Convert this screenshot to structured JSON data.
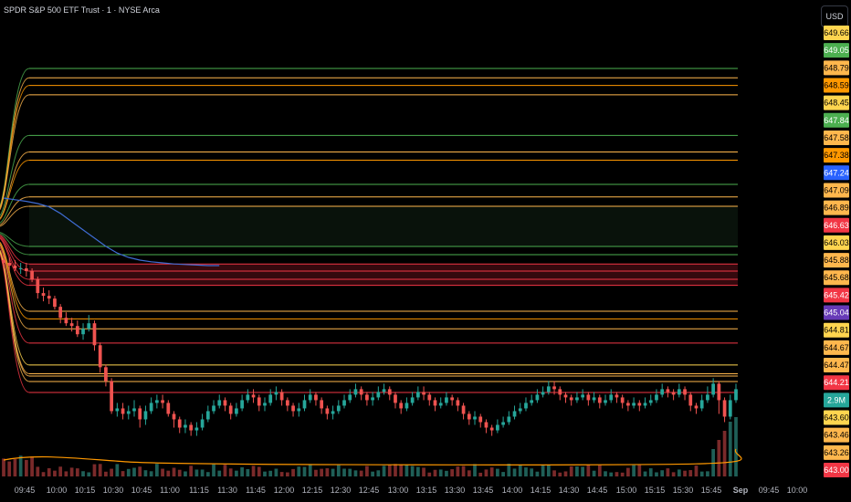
{
  "header": {
    "title": "SPDR S&P 500 ETF Trust · 1 · NYSE Arca",
    "currency": "USD"
  },
  "colors": {
    "up": "#26a69a",
    "down": "#ef5350",
    "green_level": "#4caf50",
    "orange_level": "#ffb74d",
    "red_level": "#f23645",
    "vwap": "#3f6cd3",
    "volume_ma": "#ff9800"
  },
  "chart_data": {
    "type": "candlestick",
    "ylim": [
      643.0,
      649.8
    ],
    "x_ticks": [
      "09:45",
      "10:00",
      "10:15",
      "10:30",
      "10:45",
      "11:00",
      "11:15",
      "11:30",
      "11:45",
      "12:00",
      "12:15",
      "12:30",
      "12:45",
      "13:00",
      "13:15",
      "13:30",
      "13:45",
      "14:00",
      "14:15",
      "14:30",
      "14:45",
      "15:00",
      "15:15",
      "15:30",
      "15:45",
      "Sep",
      "09:45",
      "10:00"
    ],
    "price_labels": [
      {
        "value": "649.66",
        "bg": "#ffd54f",
        "fg": "#000000"
      },
      {
        "value": "649.05",
        "bg": "#4caf50",
        "fg": "#ffffff"
      },
      {
        "value": "648.79",
        "bg": "#ffb74d",
        "fg": "#000000"
      },
      {
        "value": "648.59",
        "bg": "#ff9800",
        "fg": "#000000"
      },
      {
        "value": "648.45",
        "bg": "#ffd54f",
        "fg": "#000000"
      },
      {
        "value": "647.84",
        "bg": "#4caf50",
        "fg": "#ffffff"
      },
      {
        "value": "647.58",
        "bg": "#ffb74d",
        "fg": "#000000"
      },
      {
        "value": "647.38",
        "bg": "#ff9800",
        "fg": "#000000"
      },
      {
        "value": "647.24",
        "bg": "#2962ff",
        "fg": "#ffffff"
      },
      {
        "value": "647.09",
        "bg": "#ffb74d",
        "fg": "#000000"
      },
      {
        "value": "646.89",
        "bg": "#ffb74d",
        "fg": "#000000"
      },
      {
        "value": "646.63",
        "bg": "#f23645",
        "fg": "#ffffff"
      },
      {
        "value": "646.03",
        "bg": "#ffd54f",
        "fg": "#000000"
      },
      {
        "value": "645.88",
        "bg": "#ffb74d",
        "fg": "#000000"
      },
      {
        "value": "645.68",
        "bg": "#ffb74d",
        "fg": "#000000"
      },
      {
        "value": "645.42",
        "bg": "#f23645",
        "fg": "#ffffff"
      },
      {
        "value": "645.04",
        "bg": "#673ab7",
        "fg": "#ffffff"
      },
      {
        "value": "644.81",
        "bg": "#ffd54f",
        "fg": "#000000"
      },
      {
        "value": "644.67",
        "bg": "#ffb74d",
        "fg": "#000000"
      },
      {
        "value": "644.47",
        "bg": "#ffb74d",
        "fg": "#000000"
      },
      {
        "value": "644.21",
        "bg": "#f23645",
        "fg": "#ffffff"
      },
      {
        "value": "2.9M",
        "bg": "#26a69a",
        "fg": "#ffffff"
      },
      {
        "value": "643.60",
        "bg": "#ffd54f",
        "fg": "#000000"
      },
      {
        "value": "643.46",
        "bg": "#ffb74d",
        "fg": "#000000"
      },
      {
        "value": "643.26",
        "bg": "#ffb74d",
        "fg": "#000000"
      },
      {
        "value": "643.00",
        "bg": "#f23645",
        "fg": "#ffffff"
      }
    ],
    "levels": [
      {
        "price": 649.14,
        "color": "#4caf50"
      },
      {
        "price": 648.97,
        "color": "#ffb74d"
      },
      {
        "price": 648.83,
        "color": "#ff9800"
      },
      {
        "price": 648.66,
        "color": "#ffb74d"
      },
      {
        "price": 647.92,
        "color": "#4caf50"
      },
      {
        "price": 647.62,
        "color": "#ffb74d"
      },
      {
        "price": 647.47,
        "color": "#ff9800"
      },
      {
        "price": 647.03,
        "color": "#4caf50"
      },
      {
        "price": 646.8,
        "color": "#ffb74d"
      },
      {
        "price": 646.63,
        "color": "#ffb74d"
      },
      {
        "price": 645.9,
        "color": "#4caf50"
      },
      {
        "price": 645.75,
        "color": "#4caf50"
      },
      {
        "price": 645.58,
        "color": "#f23645"
      },
      {
        "price": 645.45,
        "color": "#f23645"
      },
      {
        "price": 645.3,
        "color": "#f23645"
      },
      {
        "price": 645.19,
        "color": "#f23645"
      },
      {
        "price": 644.72,
        "color": "#ffb74d"
      },
      {
        "price": 644.58,
        "color": "#ff9800"
      },
      {
        "price": 644.4,
        "color": "#ffb74d"
      },
      {
        "price": 644.14,
        "color": "#f23645"
      },
      {
        "price": 643.74,
        "color": "#ffd54f"
      },
      {
        "price": 643.58,
        "color": "#ffb74d"
      },
      {
        "price": 643.54,
        "color": "#ffb74d"
      },
      {
        "price": 643.44,
        "color": "#ffb74d"
      },
      {
        "price": 643.24,
        "color": "#f23645"
      }
    ],
    "candles": [
      [
        645.65,
        645.6,
        645.75,
        645.5
      ],
      [
        645.6,
        645.55,
        645.7,
        645.45
      ],
      [
        645.55,
        645.5,
        645.65,
        645.45
      ],
      [
        645.5,
        645.5,
        645.6,
        645.4
      ],
      [
        645.5,
        645.45,
        645.6,
        645.35
      ],
      [
        645.45,
        645.3,
        645.5,
        645.25
      ],
      [
        645.3,
        645.05,
        645.35,
        644.95
      ],
      [
        645.05,
        645.0,
        645.15,
        644.9
      ],
      [
        645.0,
        644.95,
        645.1,
        644.85
      ],
      [
        644.95,
        644.8,
        645.0,
        644.75
      ],
      [
        644.8,
        644.6,
        644.85,
        644.5
      ],
      [
        644.6,
        644.5,
        644.7,
        644.45
      ],
      [
        644.5,
        644.45,
        644.6,
        644.35
      ],
      [
        644.45,
        644.3,
        644.55,
        644.25
      ],
      [
        644.3,
        644.4,
        644.5,
        644.2
      ],
      [
        644.4,
        644.5,
        644.65,
        644.35
      ],
      [
        644.5,
        644.1,
        644.55,
        644.0
      ],
      [
        644.1,
        643.7,
        644.15,
        643.6
      ],
      [
        643.7,
        643.45,
        643.75,
        643.35
      ],
      [
        643.45,
        642.9,
        643.5,
        642.85
      ],
      [
        642.9,
        642.95,
        643.05,
        642.8
      ],
      [
        642.95,
        642.85,
        643.05,
        642.75
      ],
      [
        642.85,
        642.9,
        643.0,
        642.75
      ],
      [
        642.9,
        642.95,
        643.1,
        642.8
      ],
      [
        642.95,
        642.75,
        643.0,
        642.6
      ],
      [
        642.75,
        642.9,
        643.0,
        642.65
      ],
      [
        642.9,
        643.05,
        643.15,
        642.85
      ],
      [
        643.05,
        643.1,
        643.2,
        642.95
      ],
      [
        643.1,
        643.05,
        643.2,
        642.95
      ],
      [
        643.05,
        642.85,
        643.1,
        642.8
      ],
      [
        642.85,
        642.75,
        642.9,
        642.6
      ],
      [
        642.75,
        642.6,
        642.8,
        642.5
      ],
      [
        642.6,
        642.65,
        642.75,
        642.5
      ],
      [
        642.65,
        642.55,
        642.7,
        642.45
      ],
      [
        642.55,
        642.6,
        642.7,
        642.45
      ],
      [
        642.6,
        642.75,
        642.85,
        642.55
      ],
      [
        642.75,
        642.9,
        643.0,
        642.7
      ],
      [
        642.9,
        643.0,
        643.1,
        642.85
      ],
      [
        643.0,
        643.1,
        643.2,
        642.95
      ],
      [
        643.1,
        643.0,
        643.15,
        642.9
      ],
      [
        643.0,
        642.85,
        643.05,
        642.75
      ],
      [
        642.85,
        642.95,
        643.05,
        642.8
      ],
      [
        642.95,
        643.1,
        643.2,
        642.9
      ],
      [
        643.1,
        643.2,
        643.3,
        643.05
      ],
      [
        643.2,
        643.15,
        643.3,
        643.05
      ],
      [
        643.15,
        643.0,
        643.2,
        642.9
      ],
      [
        643.0,
        643.05,
        643.15,
        642.9
      ],
      [
        643.05,
        643.2,
        643.3,
        643.0
      ],
      [
        643.2,
        643.25,
        643.35,
        643.1
      ],
      [
        643.25,
        643.1,
        643.3,
        643.0
      ],
      [
        643.1,
        643.0,
        643.15,
        642.9
      ],
      [
        643.0,
        642.9,
        643.05,
        642.8
      ],
      [
        642.9,
        642.95,
        643.05,
        642.8
      ],
      [
        642.95,
        643.1,
        643.2,
        642.9
      ],
      [
        643.1,
        643.2,
        643.3,
        643.05
      ],
      [
        643.2,
        643.1,
        643.25,
        643.0
      ],
      [
        643.1,
        642.95,
        643.15,
        642.85
      ],
      [
        642.95,
        642.85,
        643.0,
        642.75
      ],
      [
        642.85,
        642.9,
        643.0,
        642.75
      ],
      [
        642.9,
        643.0,
        643.1,
        642.85
      ],
      [
        643.0,
        643.1,
        643.2,
        642.95
      ],
      [
        643.1,
        643.2,
        643.3,
        643.05
      ],
      [
        643.2,
        643.3,
        643.4,
        643.15
      ],
      [
        643.3,
        643.2,
        643.35,
        643.1
      ],
      [
        643.2,
        643.1,
        643.25,
        643.0
      ],
      [
        643.1,
        643.15,
        643.25,
        643.0
      ],
      [
        643.15,
        643.25,
        643.35,
        643.1
      ],
      [
        643.25,
        643.3,
        643.4,
        643.2
      ],
      [
        643.3,
        643.2,
        643.35,
        643.1
      ],
      [
        643.2,
        643.05,
        643.25,
        642.95
      ],
      [
        643.05,
        642.95,
        643.1,
        642.85
      ],
      [
        642.95,
        643.05,
        643.15,
        642.9
      ],
      [
        643.05,
        643.15,
        643.25,
        643.0
      ],
      [
        643.15,
        643.25,
        643.35,
        643.1
      ],
      [
        643.25,
        643.2,
        643.35,
        643.1
      ],
      [
        643.2,
        643.1,
        643.25,
        643.0
      ],
      [
        643.1,
        643.0,
        643.15,
        642.9
      ],
      [
        643.0,
        643.05,
        643.15,
        642.95
      ],
      [
        643.05,
        643.15,
        643.25,
        643.0
      ],
      [
        643.15,
        643.1,
        643.2,
        643.0
      ],
      [
        643.1,
        643.0,
        643.15,
        642.9
      ],
      [
        643.0,
        642.85,
        643.05,
        642.75
      ],
      [
        642.85,
        642.75,
        642.9,
        642.65
      ],
      [
        642.75,
        642.8,
        642.9,
        642.65
      ],
      [
        642.8,
        642.7,
        642.85,
        642.6
      ],
      [
        642.7,
        642.6,
        642.75,
        642.5
      ],
      [
        642.6,
        642.55,
        642.65,
        642.45
      ],
      [
        642.55,
        642.65,
        642.75,
        642.5
      ],
      [
        642.65,
        642.7,
        642.8,
        642.6
      ],
      [
        642.7,
        642.8,
        642.9,
        642.65
      ],
      [
        642.8,
        642.9,
        643.0,
        642.75
      ],
      [
        642.9,
        642.95,
        643.05,
        642.85
      ],
      [
        642.95,
        643.05,
        643.15,
        642.9
      ],
      [
        643.05,
        643.1,
        643.2,
        643.0
      ],
      [
        643.1,
        643.2,
        643.3,
        643.05
      ],
      [
        643.2,
        643.25,
        643.35,
        643.15
      ],
      [
        643.25,
        643.35,
        643.45,
        643.2
      ],
      [
        643.35,
        643.3,
        643.45,
        643.2
      ],
      [
        643.3,
        643.2,
        643.35,
        643.1
      ],
      [
        643.2,
        643.15,
        643.25,
        643.05
      ],
      [
        643.15,
        643.1,
        643.2,
        643.0
      ],
      [
        643.1,
        643.15,
        643.25,
        643.05
      ],
      [
        643.15,
        643.2,
        643.3,
        643.1
      ],
      [
        643.2,
        643.1,
        643.25,
        643.0
      ],
      [
        643.1,
        643.15,
        643.25,
        643.05
      ],
      [
        643.15,
        643.05,
        643.2,
        642.95
      ],
      [
        643.05,
        643.1,
        643.2,
        643.0
      ],
      [
        643.1,
        643.2,
        643.3,
        643.05
      ],
      [
        643.2,
        643.15,
        643.25,
        643.05
      ],
      [
        643.15,
        643.05,
        643.2,
        642.95
      ],
      [
        643.05,
        643.0,
        643.1,
        642.9
      ],
      [
        643.0,
        643.05,
        643.15,
        642.95
      ],
      [
        643.05,
        643.0,
        643.1,
        642.9
      ],
      [
        643.0,
        643.05,
        643.15,
        642.95
      ],
      [
        643.05,
        643.1,
        643.2,
        643.0
      ],
      [
        643.1,
        643.2,
        643.3,
        643.05
      ],
      [
        643.2,
        643.3,
        643.4,
        643.15
      ],
      [
        643.3,
        643.25,
        643.35,
        643.15
      ],
      [
        643.25,
        643.2,
        643.3,
        643.1
      ],
      [
        643.2,
        643.3,
        643.4,
        643.15
      ],
      [
        643.3,
        643.2,
        643.35,
        643.1
      ],
      [
        643.2,
        643.0,
        643.25,
        642.9
      ],
      [
        643.0,
        642.95,
        643.05,
        642.85
      ],
      [
        642.95,
        643.1,
        643.2,
        642.9
      ],
      [
        643.1,
        643.2,
        643.35,
        643.05
      ],
      [
        643.2,
        643.4,
        643.5,
        643.15
      ],
      [
        643.4,
        643.1,
        643.45,
        642.85
      ],
      [
        643.1,
        642.8,
        643.15,
        642.7
      ],
      [
        642.8,
        643.1,
        643.2,
        642.75
      ],
      [
        643.1,
        643.3,
        643.4,
        643.05
      ]
    ],
    "vwap": [
      646.78,
      646.75,
      646.72,
      646.68,
      646.62,
      646.5,
      646.35,
      646.2,
      646.05,
      645.9,
      645.78,
      645.7,
      645.65,
      645.62,
      645.6,
      645.58,
      645.57,
      645.56,
      645.55,
      645.55
    ],
    "volume_ma_level": 0.9
  }
}
